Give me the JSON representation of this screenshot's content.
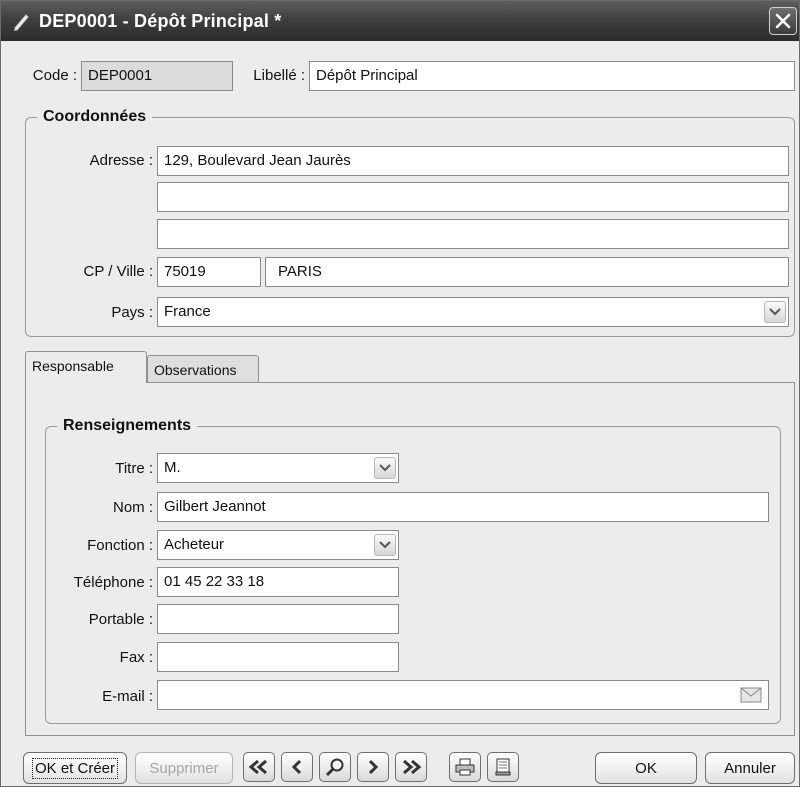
{
  "window": {
    "title": "DEP0001 - Dépôt Principal *"
  },
  "header": {
    "code_label": "Code :",
    "code_value": "DEP0001",
    "libelle_label": "Libellé :",
    "libelle_value": "Dépôt Principal"
  },
  "coordonnees": {
    "legend": "Coordonnées",
    "adresse_label": "Adresse :",
    "adresse_line1": "129, Boulevard Jean Jaurès",
    "adresse_line2": "",
    "adresse_line3": "",
    "cp_ville_label": "CP / Ville :",
    "cp": "75019",
    "ville": "PARIS",
    "pays_label": "Pays :",
    "pays": "France"
  },
  "tabs": [
    {
      "label": "Responsable",
      "active": true
    },
    {
      "label": "Observations",
      "active": false
    }
  ],
  "renseignements": {
    "legend": "Renseignements",
    "titre_label": "Titre :",
    "titre": "M.",
    "nom_label": "Nom :",
    "nom": "Gilbert Jeannot",
    "fonction_label": "Fonction :",
    "fonction": "Acheteur",
    "telephone_label": "Téléphone :",
    "telephone": "01 45 22 33 18",
    "portable_label": "Portable :",
    "portable": "",
    "fax_label": "Fax :",
    "fax": "",
    "email_label": "E-mail :",
    "email": ""
  },
  "footer": {
    "ok_creer": "OK et Créer",
    "supprimer": "Supprimer",
    "ok": "OK",
    "annuler": "Annuler"
  },
  "icons": {
    "title": "pencil-icon",
    "close": "close-icon",
    "nav": [
      "first-record-icon",
      "previous-record-icon",
      "search-icon",
      "next-record-icon",
      "last-record-icon"
    ],
    "print": "print-icon",
    "preview": "preview-icon",
    "email": "envelope-icon",
    "dropdown": "chevron-down-icon"
  }
}
